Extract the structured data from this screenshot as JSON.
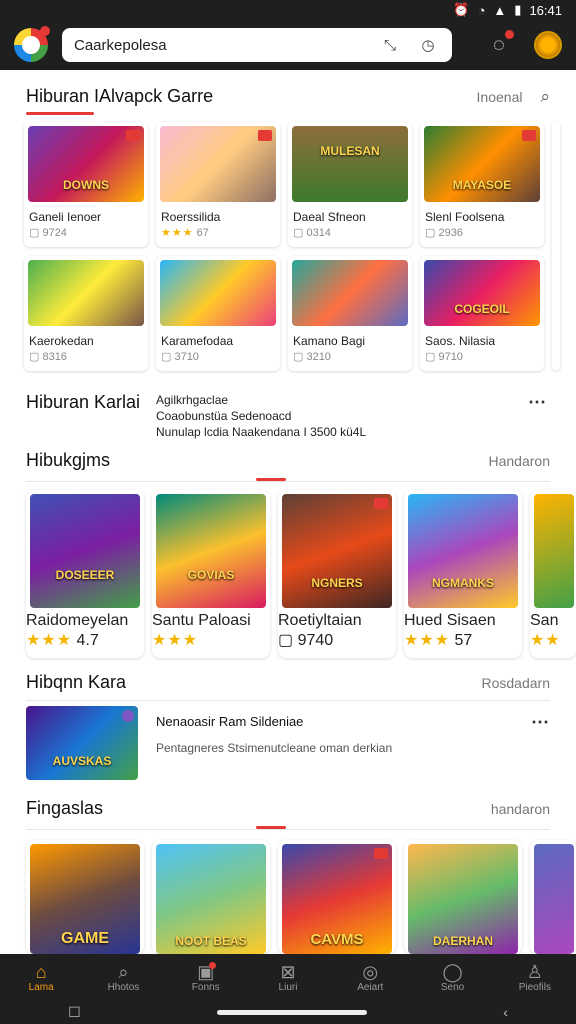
{
  "status": {
    "time": "16:41"
  },
  "appbar": {
    "search_value": "Caarkepolesa"
  },
  "section1": {
    "title": "Hiburan IAlvapck Garre",
    "link": "Inoenal",
    "cards": [
      {
        "name": "Ganeli Ienoer",
        "meta": "9724"
      },
      {
        "name": "Roerssilida",
        "stars": "★★★",
        "meta": "67"
      },
      {
        "name": "Daeal Sfneon",
        "meta": "0314"
      },
      {
        "name": "Slenl Foolsena",
        "meta": "2936"
      },
      {
        "name": "Kaerokedan",
        "meta": "8316"
      },
      {
        "name": "Karamefodaa",
        "meta": "3710"
      },
      {
        "name": "Kamano Bagi",
        "meta": "3210"
      },
      {
        "name": "Saos. Nilasia",
        "meta": "9710"
      }
    ],
    "thumb_titles": [
      "DOWNS",
      "",
      "MULESAN",
      "MAYASOE",
      "",
      "",
      "",
      "COGEOIL"
    ]
  },
  "section2": {
    "title": "Hiburan Karlai",
    "line1": "Agilkrhgaclae",
    "line2": "Coaobunstüa Sedenoacd",
    "line3": "Nunulap lcdia Naakendana I 3500 kü4L"
  },
  "section3": {
    "title": "Hibukgjms",
    "link": "Handaron",
    "cards": [
      {
        "name": "Raidomeyelan",
        "stars": "★★★",
        "meta": "4.7"
      },
      {
        "name": "Santu Paloasi",
        "stars": "★★★",
        "meta": ""
      },
      {
        "name": "Roetiyltaian",
        "meta": "9740"
      },
      {
        "name": "Hued Sisaen",
        "stars": "★★★",
        "meta": "57"
      },
      {
        "name": "San",
        "stars": "★★",
        "meta": ""
      }
    ],
    "thumb_titles": [
      "DOSEEER",
      "GOVIAS",
      "NGNERS",
      "NGMANKS",
      ""
    ]
  },
  "section4": {
    "title": "Hibqnn Kara",
    "link": "Rosdadarn",
    "item_title": "Nenaoasir Ram Sildeniae",
    "item_desc": "Pentagneres Stsimenutcleane oman derkian",
    "thumb_title": "AUVSKAS"
  },
  "section5": {
    "title": "Fingaslas",
    "link": "handaron",
    "thumb_titles": [
      "GAME",
      "NOOT BEAS",
      "CAVMS",
      "DAERHAN",
      ""
    ]
  },
  "bottomnav": [
    {
      "label": "Lama",
      "icon": "⌂"
    },
    {
      "label": "Hhotos",
      "icon": "⌕"
    },
    {
      "label": "Fonns",
      "icon": "▣"
    },
    {
      "label": "Liuri",
      "icon": "⊠"
    },
    {
      "label": "Aeiart",
      "icon": "◎"
    },
    {
      "label": "Seno",
      "icon": "◯"
    },
    {
      "label": "Pieofils",
      "icon": "♙"
    }
  ],
  "colors": {
    "accent": "#e53935",
    "active_nav": "#f39c12",
    "bar": "#1f1f1f"
  }
}
